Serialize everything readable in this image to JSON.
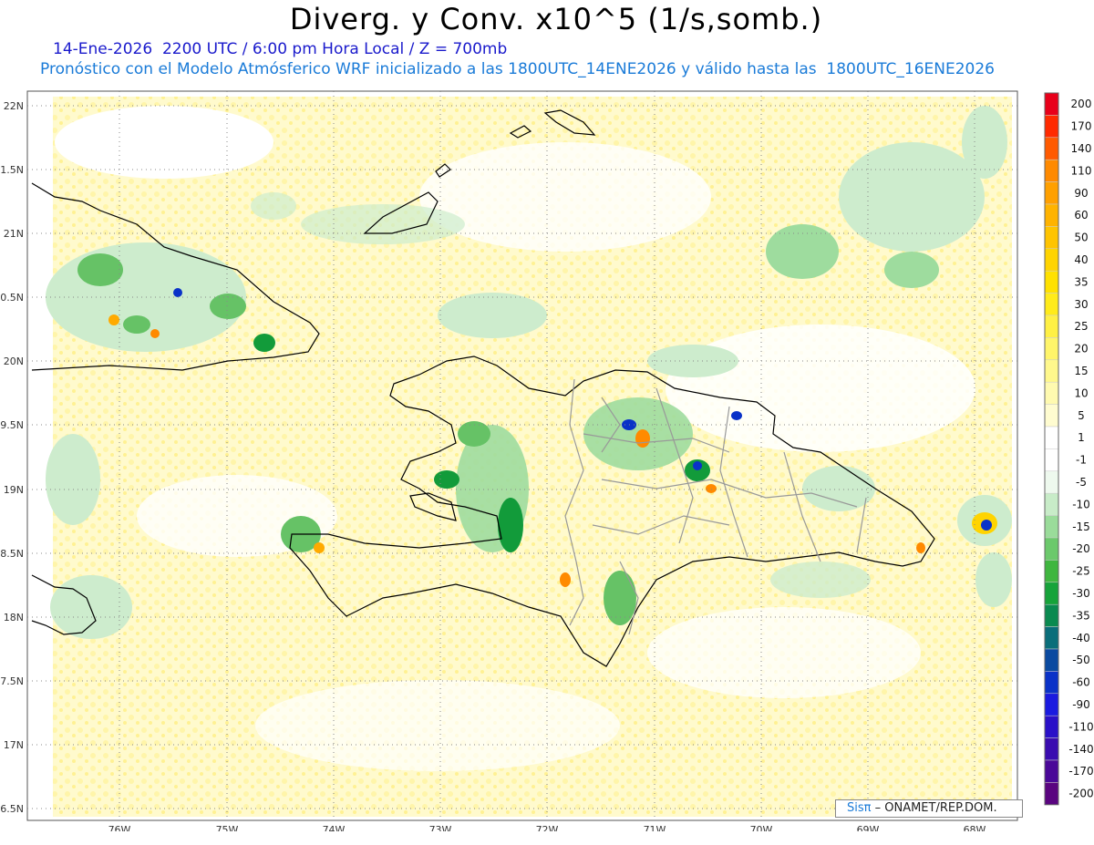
{
  "header": {
    "title": "Diverg. y Conv. x10^5 (1/s,somb.)",
    "line1": "14-Ene-2026  2200 UTC / 6:00 pm Hora Local / Z = 700mb",
    "line2": "Pronóstico con el Modelo Atmósferico WRF inicializado a las 1800UTC_14ENE2026 y válido hasta las  1800UTC_16ENE2026"
  },
  "map": {
    "lat_labels": [
      "22N",
      "1.5N",
      "21N",
      "0.5N",
      "20N",
      "9.5N",
      "19N",
      "8.5N",
      "18N",
      "7.5N",
      "17N",
      "6.5N"
    ],
    "lon_labels": [
      "76W",
      "75W",
      "74W",
      "73W",
      "72W",
      "71W",
      "70W",
      "69W",
      "68W"
    ],
    "colors": {
      "yellow": "#fff7a8",
      "pale_green": "#cdeccd",
      "green": "#66c266",
      "dark_green": "#129b3a",
      "coast": "#000000",
      "border": "#999999"
    }
  },
  "colorbar": {
    "labels": [
      "200",
      "170",
      "140",
      "110",
      "90",
      "60",
      "50",
      "40",
      "35",
      "30",
      "25",
      "20",
      "15",
      "10",
      "5",
      "1",
      "-1",
      "-5",
      "-10",
      "-15",
      "-20",
      "-25",
      "-30",
      "-35",
      "-40",
      "-50",
      "-60",
      "-90",
      "-110",
      "-140",
      "-170",
      "-200"
    ],
    "colors": [
      "#e8001a",
      "#ff2a00",
      "#ff5a00",
      "#ff8a00",
      "#ffa000",
      "#ffb300",
      "#ffc400",
      "#ffd400",
      "#ffe100",
      "#ffeb1a",
      "#fff044",
      "#fff56a",
      "#fff88c",
      "#fffab0",
      "#fffcd0",
      "#ffffff",
      "#ffffff",
      "#eef9ee",
      "#c8ecc8",
      "#9adc9a",
      "#6cc96c",
      "#3fb63f",
      "#16a33a",
      "#0a8a50",
      "#0a6e7a",
      "#0a4aa0",
      "#0a32c8",
      "#1a1ae0",
      "#2a10c8",
      "#3a0cb0",
      "#4a0898",
      "#5a0480"
    ]
  },
  "credit": {
    "brand": "Sisπ",
    "org": " – ONAMET/REP.DOM."
  }
}
